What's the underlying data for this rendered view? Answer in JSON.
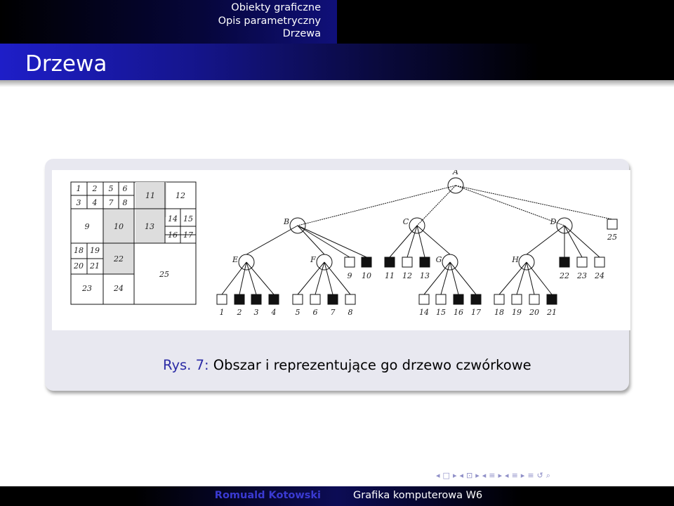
{
  "header": {
    "sections": [
      "Obiekty graficzne",
      "Opis parametryczny",
      "Drzewa"
    ],
    "frame_title": "Drzewa"
  },
  "figure": {
    "caption_label": "Rys. 7:",
    "caption_text": "Obszar i reprezentujące go drzewo czwórkowe",
    "grid_labels": [
      "1",
      "2",
      "5",
      "6",
      "11",
      "12",
      "3",
      "4",
      "7",
      "8",
      "9",
      "10",
      "13",
      "14",
      "15",
      "16",
      "17",
      "18",
      "19",
      "22",
      "20",
      "21",
      "25",
      "23",
      "24"
    ],
    "tree_root": "A",
    "tree_level1": [
      "B",
      "C",
      "D"
    ],
    "tree_level1_extra": [
      "25"
    ],
    "tree_level2": [
      "E",
      "F",
      "G",
      "H"
    ],
    "tree_level2_leaves": [
      "9",
      "10",
      "11",
      "12",
      "13",
      "22",
      "23",
      "24"
    ],
    "tree_level3_leaves": [
      "1",
      "2",
      "3",
      "4",
      "5",
      "6",
      "7",
      "8",
      "14",
      "15",
      "16",
      "17",
      "18",
      "19",
      "20",
      "21"
    ],
    "black_leaves": [
      "2",
      "3",
      "4",
      "7",
      "10",
      "11",
      "13",
      "16",
      "17",
      "21",
      "22"
    ]
  },
  "footer": {
    "author": "Romuald Kotowski",
    "course": "Grafika komputerowa W6"
  },
  "nav": {
    "icons": [
      "◂",
      "□",
      "▸",
      "◂",
      "⊡",
      "▸",
      "◂",
      "≡",
      "▸",
      "◂",
      "≡",
      "▸",
      "≡",
      "↺",
      "⌕"
    ]
  }
}
